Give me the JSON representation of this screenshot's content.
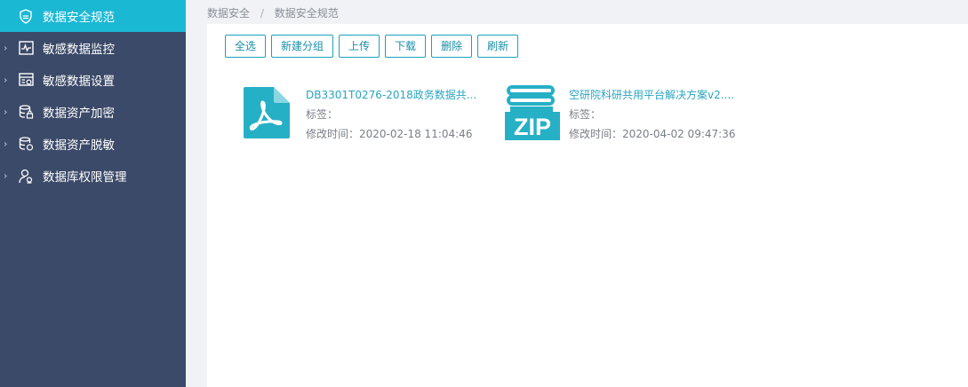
{
  "sidebar": {
    "items": [
      {
        "label": "数据安全规范",
        "icon": "shield-icon",
        "active": true
      },
      {
        "label": "敏感数据监控",
        "icon": "monitor-icon"
      },
      {
        "label": "敏感数据设置",
        "icon": "settings-panel-icon"
      },
      {
        "label": "数据资产加密",
        "icon": "database-lock-icon"
      },
      {
        "label": "数据资产脱敏",
        "icon": "database-mask-icon"
      },
      {
        "label": "数据库权限管理",
        "icon": "user-permission-icon"
      }
    ]
  },
  "breadcrumb": {
    "root": "数据安全",
    "separator": "/",
    "current": "数据安全规范"
  },
  "toolbar": {
    "select_all": "全选",
    "new_group": "新建分组",
    "upload": "上传",
    "download": "下载",
    "delete": "删除",
    "refresh": "刷新"
  },
  "files": [
    {
      "name": "DB3301T0276-2018政务数据共...",
      "tag_label": "标签：",
      "modified": "修改时间：2020-02-18 11:04:46",
      "icon": "pdf-file-icon"
    },
    {
      "name": "空研院科研共用平台解决方案v2....",
      "tag_label": "标签：",
      "modified": "修改时间：2020-04-02 09:47:36",
      "icon": "zip-file-icon"
    }
  ],
  "colors": {
    "sidebar_bg": "#3b4a68",
    "active": "#1bb8d4",
    "accent": "#1aa3bc",
    "file_icon": "#26b0c6"
  }
}
